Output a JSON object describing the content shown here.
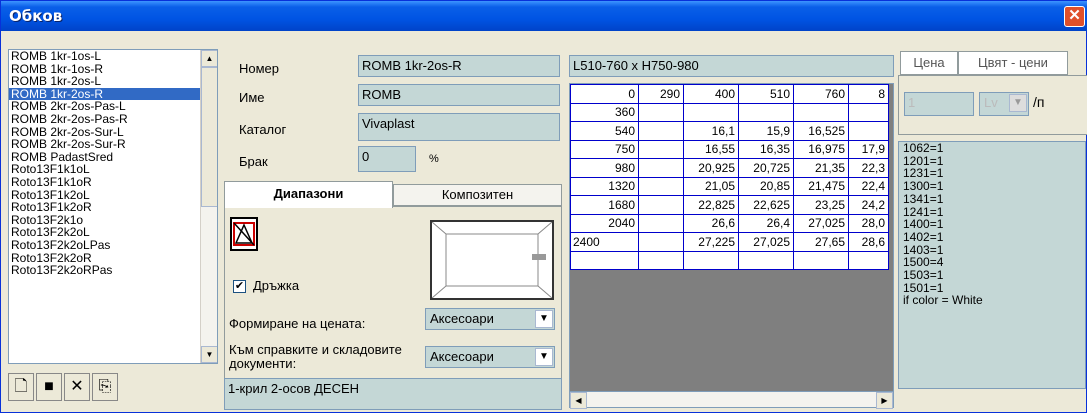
{
  "window": {
    "title": "Обков"
  },
  "list": {
    "items": [
      "ROMB 1kr-1os-L",
      "ROMB 1kr-1os-R",
      "ROMB 1kr-2os-L",
      "ROMB 1kr-2os-R",
      "ROMB 2kr-2os-Pas-L",
      "ROMB 2kr-2os-Pas-R",
      "ROMB 2kr-2os-Sur-L",
      "ROMB 2kr-2os-Sur-R",
      "ROMB PadastSred",
      "Roto13F1k1oL",
      "Roto13F1k1oR",
      "Roto13F1k2oL",
      "Roto13F1k2oR",
      "Roto13F2k1o",
      "Roto13F2k2oL",
      "Roto13F2k2oLPas",
      "Roto13F2k2oR",
      "Roto13F2k2oRPas"
    ],
    "selected_index": 3
  },
  "toolbar": {
    "new_icon": "document-icon",
    "save_icon": "floppy-icon",
    "delete_icon": "close-icon",
    "export_icon": "export-icon"
  },
  "form": {
    "number_label": "Номер",
    "number_value": "ROMB 1kr-2os-R",
    "name_label": "Име",
    "name_value": "ROMB",
    "catalog_label": "Каталог",
    "catalog_value": "Vivaplast",
    "defect_label": "Брак",
    "defect_value": "0",
    "defect_unit": "%"
  },
  "tabs": {
    "ranges": "Диапазони",
    "composite": "Композитен"
  },
  "ranges_panel": {
    "handle_checkbox_label": "Дръжка",
    "handle_checked": true,
    "price_formation_label": "Формиране на цената:",
    "price_formation_value": "Аксесоари",
    "to_reports_label": "Към справките и складовите документи:",
    "to_reports_value": "Аксесоари"
  },
  "description": "1-крил 2-осов ДЕСЕН",
  "grid": {
    "range_label": "L510-760 x H750-980",
    "header": [
      "0",
      "290",
      "400",
      "510",
      "760",
      "8"
    ],
    "rows": [
      {
        "h": "360",
        "cells": [
          "",
          "",
          "",
          "",
          ""
        ]
      },
      {
        "h": "540",
        "cells": [
          "",
          "16,1",
          "15,9",
          "16,525",
          ""
        ]
      },
      {
        "h": "750",
        "cells": [
          "",
          "16,55",
          "16,35",
          "16,975",
          "17,9"
        ]
      },
      {
        "h": "980",
        "cells": [
          "",
          "20,925",
          "20,725",
          "21,35",
          "22,3"
        ]
      },
      {
        "h": "1320",
        "cells": [
          "",
          "21,05",
          "20,85",
          "21,475",
          "22,4"
        ]
      },
      {
        "h": "1680",
        "cells": [
          "",
          "22,825",
          "22,625",
          "23,25",
          "24,2"
        ]
      },
      {
        "h": "2040",
        "cells": [
          "",
          "26,6",
          "26,4",
          "27,025",
          "28,0"
        ]
      },
      {
        "h": "2400",
        "cells": [
          "",
          "27,225",
          "27,025",
          "27,65",
          "28,6"
        ]
      }
    ]
  },
  "right_panel": {
    "tab_price": "Цена",
    "tab_color_prices": "Цвят - цени",
    "price_value": "1",
    "currency": "Lv",
    "per_unit": "/п",
    "lines": [
      "1062=1",
      "1201=1",
      "1231=1",
      "1300=1",
      "1341=1",
      "1241=1",
      "1400=1",
      "1402=1",
      "1403=1",
      "1500=4",
      "1503=1",
      "1501=1",
      "if color = White"
    ]
  }
}
